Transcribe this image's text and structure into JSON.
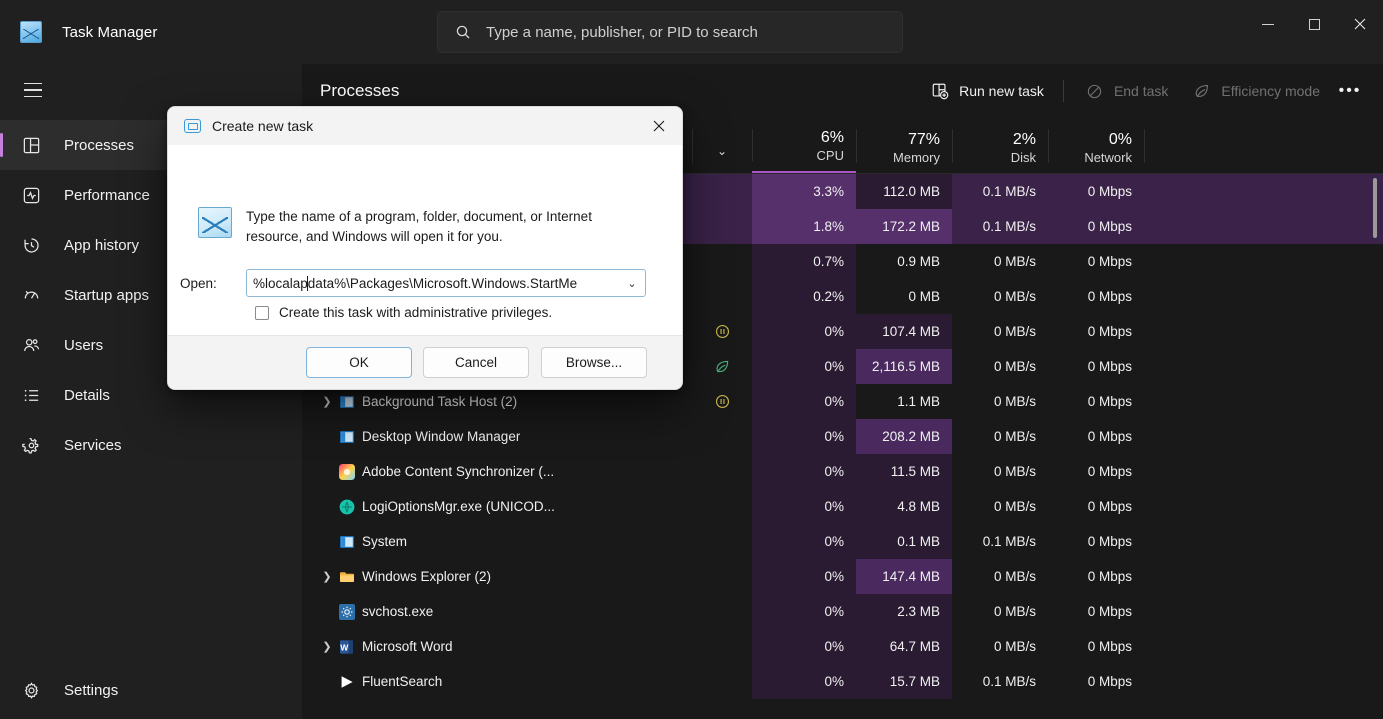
{
  "window": {
    "app_title": "Task Manager",
    "app_icon": "task-manager-icon",
    "minimize": "–",
    "maximize": "□",
    "close": "✕"
  },
  "search": {
    "placeholder": "Type a name, publisher, or PID to search",
    "value": "",
    "icon": "search-icon"
  },
  "sidebar": {
    "menu_icon": "hamburger-icon",
    "items": [
      {
        "label": "Processes",
        "icon": "processes-icon",
        "active": true
      },
      {
        "label": "Performance",
        "icon": "performance-icon",
        "active": false
      },
      {
        "label": "App history",
        "icon": "history-icon",
        "active": false
      },
      {
        "label": "Startup apps",
        "icon": "startup-icon",
        "active": false
      },
      {
        "label": "Users",
        "icon": "users-icon",
        "active": false
      },
      {
        "label": "Details",
        "icon": "details-icon",
        "active": false
      },
      {
        "label": "Services",
        "icon": "services-icon",
        "active": false
      }
    ],
    "settings": {
      "label": "Settings",
      "icon": "gear-icon"
    }
  },
  "toolbar": {
    "page_title": "Processes",
    "run_new_task": "Run new task",
    "end_task": "End task",
    "efficiency_mode": "Efficiency mode",
    "more_options": "•••",
    "end_task_disabled": true,
    "efficiency_mode_disabled": true
  },
  "table": {
    "columns": [
      {
        "key": "name",
        "pct": "",
        "name": "",
        "sorted": false
      },
      {
        "key": "status",
        "pct": "",
        "name": "",
        "sorted": false
      },
      {
        "key": "cpu",
        "pct": "6%",
        "name": "CPU",
        "sorted": true
      },
      {
        "key": "memory",
        "pct": "77%",
        "name": "Memory",
        "sorted": false
      },
      {
        "key": "disk",
        "pct": "2%",
        "name": "Disk",
        "sorted": false
      },
      {
        "key": "network",
        "pct": "0%",
        "name": "Network",
        "sorted": false
      }
    ],
    "sort_indicator": "⌄",
    "rows": [
      {
        "name": "",
        "hidden": true,
        "expandable": false,
        "icon": "",
        "status": "",
        "cpu": "3.3%",
        "memory": "112.0 MB",
        "disk": "0.1 MB/s",
        "network": "0 Mbps",
        "cpu_heat": 2,
        "mem_heat": 1,
        "selected": true
      },
      {
        "name": "",
        "hidden": true,
        "expandable": false,
        "icon": "",
        "status": "",
        "cpu": "1.8%",
        "memory": "172.2 MB",
        "disk": "0.1 MB/s",
        "network": "0 Mbps",
        "cpu_heat": 2,
        "mem_heat": 2,
        "selected": true
      },
      {
        "name": "",
        "hidden": true,
        "expandable": false,
        "icon": "",
        "status": "",
        "cpu": "0.7%",
        "memory": "0.9 MB",
        "disk": "0 MB/s",
        "network": "0 Mbps",
        "cpu_heat": 1,
        "mem_heat": 0,
        "selected": false
      },
      {
        "name": "",
        "hidden": true,
        "expandable": false,
        "icon": "",
        "status": "",
        "cpu": "0.2%",
        "memory": "0 MB",
        "disk": "0 MB/s",
        "network": "0 Mbps",
        "cpu_heat": 1,
        "mem_heat": 0,
        "selected": false
      },
      {
        "name": "",
        "hidden": true,
        "expandable": false,
        "icon": "",
        "status": "suspended",
        "cpu": "0%",
        "memory": "107.4 MB",
        "disk": "0 MB/s",
        "network": "0 Mbps",
        "cpu_heat": 1,
        "mem_heat": 1,
        "selected": false
      },
      {
        "name": "",
        "hidden": true,
        "expandable": false,
        "icon": "",
        "status": "efficiency",
        "cpu": "0%",
        "memory": "2,116.5 MB",
        "disk": "0 MB/s",
        "network": "0 Mbps",
        "cpu_heat": 1,
        "mem_heat": 3,
        "selected": false
      },
      {
        "name": "Background Task Host (2)",
        "hidden": false,
        "expandable": true,
        "icon": "bg-task-icon",
        "status": "suspended",
        "cpu": "0%",
        "memory": "1.1 MB",
        "disk": "0 MB/s",
        "network": "0 Mbps",
        "cpu_heat": 1,
        "mem_heat": 0,
        "selected": false
      },
      {
        "name": "Desktop Window Manager",
        "hidden": false,
        "expandable": false,
        "icon": "dwm-icon",
        "status": "",
        "cpu": "0%",
        "memory": "208.2 MB",
        "disk": "0 MB/s",
        "network": "0 Mbps",
        "cpu_heat": 1,
        "mem_heat": 3,
        "selected": false
      },
      {
        "name": "Adobe Content Synchronizer (...",
        "hidden": false,
        "expandable": false,
        "icon": "adobe-icon",
        "status": "",
        "cpu": "0%",
        "memory": "11.5 MB",
        "disk": "0 MB/s",
        "network": "0 Mbps",
        "cpu_heat": 1,
        "mem_heat": 1,
        "selected": false
      },
      {
        "name": "LogiOptionsMgr.exe (UNICOD...",
        "hidden": false,
        "expandable": false,
        "icon": "logi-icon",
        "status": "",
        "cpu": "0%",
        "memory": "4.8 MB",
        "disk": "0 MB/s",
        "network": "0 Mbps",
        "cpu_heat": 1,
        "mem_heat": 1,
        "selected": false
      },
      {
        "name": "System",
        "hidden": false,
        "expandable": false,
        "icon": "system-icon",
        "status": "",
        "cpu": "0%",
        "memory": "0.1 MB",
        "disk": "0.1 MB/s",
        "network": "0 Mbps",
        "cpu_heat": 1,
        "mem_heat": 1,
        "selected": false
      },
      {
        "name": "Windows Explorer (2)",
        "hidden": false,
        "expandable": true,
        "icon": "folder-icon",
        "status": "",
        "cpu": "0%",
        "memory": "147.4 MB",
        "disk": "0 MB/s",
        "network": "0 Mbps",
        "cpu_heat": 1,
        "mem_heat": 3,
        "selected": false
      },
      {
        "name": "svchost.exe",
        "hidden": false,
        "expandable": false,
        "icon": "svchost-icon",
        "status": "",
        "cpu": "0%",
        "memory": "2.3 MB",
        "disk": "0 MB/s",
        "network": "0 Mbps",
        "cpu_heat": 1,
        "mem_heat": 1,
        "selected": false
      },
      {
        "name": "Microsoft Word",
        "hidden": false,
        "expandable": true,
        "icon": "word-icon",
        "status": "",
        "cpu": "0%",
        "memory": "64.7 MB",
        "disk": "0 MB/s",
        "network": "0 Mbps",
        "cpu_heat": 1,
        "mem_heat": 1,
        "selected": false
      },
      {
        "name": "FluentSearch",
        "hidden": false,
        "expandable": false,
        "icon": "fluent-icon",
        "status": "",
        "cpu": "0%",
        "memory": "15.7 MB",
        "disk": "0.1 MB/s",
        "network": "0 Mbps",
        "cpu_heat": 1,
        "mem_heat": 1,
        "selected": false
      }
    ]
  },
  "dialog": {
    "title": "Create new task",
    "title_icon": "window-icon",
    "close": "✕",
    "description": "Type the name of a program, folder, document, or Internet resource, and Windows will open it for you.",
    "open_label": "Open:",
    "open_value_before_caret": "%localap",
    "open_value_after_caret": "data%\\Packages\\Microsoft.Windows.StartMe",
    "open_value": "%localappdata%\\Packages\\Microsoft.Windows.StartMe",
    "combo_chevron": "⌄",
    "checkbox_label": "Create this task with administrative privileges.",
    "checkbox_checked": false,
    "ok": "OK",
    "cancel": "Cancel",
    "browse": "Browse..."
  },
  "colors": {
    "accent": "#c77fdd",
    "sort_underline": "#a855c8",
    "suspended": "#c8b84a",
    "efficiency": "#4caf7d",
    "window_bg": "#191919",
    "chrome_bg": "#202020"
  }
}
